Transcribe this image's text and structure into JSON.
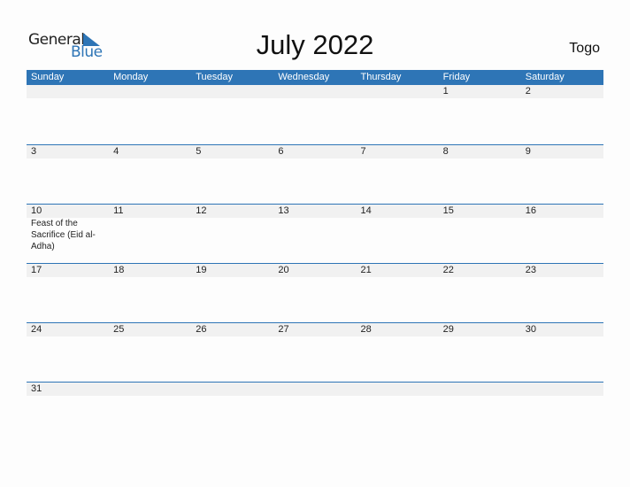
{
  "logo": {
    "word1": "General",
    "word2": "Blue"
  },
  "title": "July 2022",
  "country": "Togo",
  "accent_color": "#2e75b6",
  "weekdays": [
    "Sunday",
    "Monday",
    "Tuesday",
    "Wednesday",
    "Thursday",
    "Friday",
    "Saturday"
  ],
  "weeks": [
    [
      {
        "d": ""
      },
      {
        "d": ""
      },
      {
        "d": ""
      },
      {
        "d": ""
      },
      {
        "d": ""
      },
      {
        "d": "1"
      },
      {
        "d": "2"
      }
    ],
    [
      {
        "d": "3"
      },
      {
        "d": "4"
      },
      {
        "d": "5"
      },
      {
        "d": "6"
      },
      {
        "d": "7"
      },
      {
        "d": "8"
      },
      {
        "d": "9"
      }
    ],
    [
      {
        "d": "10",
        "event": "Feast of the Sacrifice (Eid al-Adha)"
      },
      {
        "d": "11"
      },
      {
        "d": "12"
      },
      {
        "d": "13"
      },
      {
        "d": "14"
      },
      {
        "d": "15"
      },
      {
        "d": "16"
      }
    ],
    [
      {
        "d": "17"
      },
      {
        "d": "18"
      },
      {
        "d": "19"
      },
      {
        "d": "20"
      },
      {
        "d": "21"
      },
      {
        "d": "22"
      },
      {
        "d": "23"
      }
    ],
    [
      {
        "d": "24"
      },
      {
        "d": "25"
      },
      {
        "d": "26"
      },
      {
        "d": "27"
      },
      {
        "d": "28"
      },
      {
        "d": "29"
      },
      {
        "d": "30"
      }
    ],
    [
      {
        "d": "31"
      },
      {
        "d": ""
      },
      {
        "d": ""
      },
      {
        "d": ""
      },
      {
        "d": ""
      },
      {
        "d": ""
      },
      {
        "d": ""
      }
    ]
  ]
}
